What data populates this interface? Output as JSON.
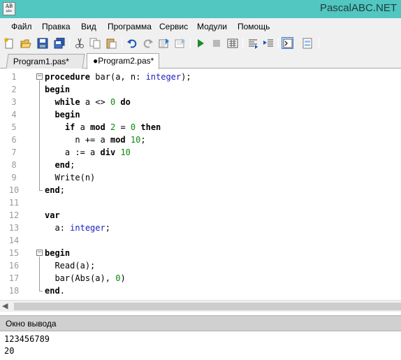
{
  "window": {
    "title": "PascalABC.NET",
    "icon_text_top": "AB",
    "icon_text_bottom": "abc"
  },
  "menu": [
    "Файл",
    "Правка",
    "Вид",
    "Программа",
    "Сервис",
    "Модули",
    "Помощь"
  ],
  "toolbar": {
    "icons": [
      "new-file-icon",
      "open-icon",
      "save-icon",
      "save-all-icon",
      "cut-icon",
      "copy-icon",
      "paste-icon",
      "undo-icon",
      "redo-icon",
      "compile-icon",
      "build-icon",
      "run-icon",
      "stop-icon",
      "debug-icon",
      "step-over-icon",
      "step-into-icon",
      "output-window-icon",
      "form-designer-icon"
    ],
    "pressed": "output-window-icon"
  },
  "tabs": [
    {
      "label": "Program1.pas*",
      "active": false
    },
    {
      "label": "●Program2.pas*",
      "active": true
    }
  ],
  "editor": {
    "lines": [
      {
        "n": "1",
        "code": "procedure bar(a, n: integer);"
      },
      {
        "n": "2",
        "code": "begin"
      },
      {
        "n": "3",
        "code": "  while a <> 0 do"
      },
      {
        "n": "4",
        "code": "  begin"
      },
      {
        "n": "5",
        "code": "    if a mod 2 = 0 then"
      },
      {
        "n": "6",
        "code": "      n += a mod 10;"
      },
      {
        "n": "7",
        "code": "    a := a div 10"
      },
      {
        "n": "8",
        "code": "  end;"
      },
      {
        "n": "9",
        "code": "  Write(n)"
      },
      {
        "n": "10",
        "code": "end;"
      },
      {
        "n": "11",
        "code": ""
      },
      {
        "n": "12",
        "code": "var"
      },
      {
        "n": "13",
        "code": "  a: integer;"
      },
      {
        "n": "14",
        "code": ""
      },
      {
        "n": "15",
        "code": "begin"
      },
      {
        "n": "16",
        "code": "  Read(a);"
      },
      {
        "n": "17",
        "code": "  bar(Abs(a), 0)"
      },
      {
        "n": "18",
        "code": "end."
      }
    ],
    "keywords": [
      "procedure",
      "begin",
      "while",
      "do",
      "if",
      "mod",
      "then",
      "div",
      "end",
      "var"
    ],
    "types": [
      "integer"
    ],
    "colors": {
      "keyword": "#000000",
      "type": "#2020c0",
      "number": "#0a8a0a",
      "line_number": "#9a9a9a"
    }
  },
  "output_panel": {
    "title": "Окно вывода",
    "lines": [
      "123456789",
      "20"
    ]
  },
  "colors": {
    "titlebar": "#52c6c0",
    "chrome": "#f0f0f0",
    "output_header": "#d0d0d0"
  }
}
